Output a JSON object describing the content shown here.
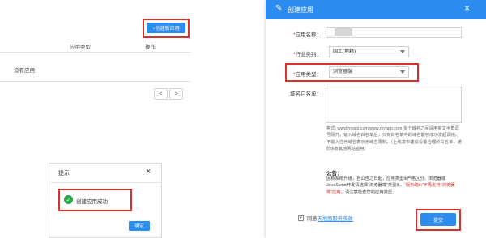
{
  "app_list": {
    "create_button": "+创建新应用",
    "columns": [
      "应用类型",
      "操作"
    ],
    "empty_text": "没有应用",
    "pager": {
      "prev": "<",
      "next": ">"
    }
  },
  "success_dialog": {
    "title": "提示",
    "close": "×",
    "message": "创建应用成功",
    "ok_button": "确定"
  },
  "create_modal": {
    "title": "创建应用",
    "close": "×",
    "fields": {
      "app_name": {
        "label": "应用名称：",
        "value": ""
      },
      "industry": {
        "label": "行业类别：",
        "value": "国土(地籍)"
      },
      "app_type": {
        "label": "应用类型：",
        "value": "浏览器端"
      },
      "whitelist": {
        "label": "域名白名单：",
        "value": ""
      }
    },
    "hint": "格式: www.myapi.com,www.myapp.com 多个域名之间请用英文半角逗号隔开。输入域名白名单后，只有白名单中的域名能够成功发起调用。不输入任何域名表示无域名限制。（上线发布建议设置合理的白名单，谨防tk被其他网站盗用）",
    "notice_title": "公告：",
    "notice_part1": "因新系统升级，自公告之日起，应用类型tk严格区分，浏览器端JavaScript开发请选择“浏览器端”类型tk，",
    "notice_red": "“服务端tk”不再支持“浏览器端”应用。",
    "notice_part2": "请注意检查您的应用类型。",
    "agree_prefix": "同意",
    "agree_link": "天地图服务条款",
    "submit": "提交"
  }
}
